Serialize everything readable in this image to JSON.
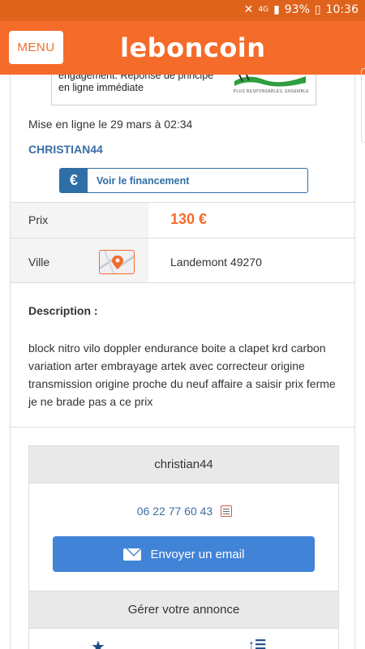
{
  "status_bar": {
    "network": "4G",
    "battery": "93%",
    "time": "10:36"
  },
  "header": {
    "menu_label": "MENU",
    "logo_text": "leboncoin"
  },
  "ad_banner": {
    "lines": [
      "engagement. Réponse de principe",
      "en ligne immédiate"
    ],
    "tagline": "PLUS RESPONSABLES, ENSEMBLE"
  },
  "listing": {
    "posted_at": "Mise en ligne le 29 mars à 02:34",
    "seller": "CHRISTIAN44",
    "finance_label": "Voir le financement",
    "finance_icon": "€",
    "price_label": "Prix",
    "price": "130 €",
    "city_label": "Ville",
    "city": "Landemont 49270",
    "description_title": "Description :",
    "description": "block nitro vilo doppler endurance boite a clapet krd carbon variation arter embrayage artek avec correcteur origine transmission origine proche du neuf affaire a saisir prix ferme je ne brade pas a ce prix"
  },
  "contact": {
    "username": "christian44",
    "phone": "06 22 77 60 43",
    "email_button": "Envoyer un email"
  },
  "manage": {
    "title": "Gérer votre annonce"
  },
  "colors": {
    "brand_orange": "#f56b2a",
    "link_blue": "#3a6ea5",
    "button_blue": "#4183d7",
    "status_bar": "#e0631c"
  },
  "icons": {
    "map": "map-pin-icon",
    "envelope": "envelope-icon",
    "star": "star-icon",
    "sort": "sort-icon",
    "phone_image": "phone-image-icon"
  }
}
